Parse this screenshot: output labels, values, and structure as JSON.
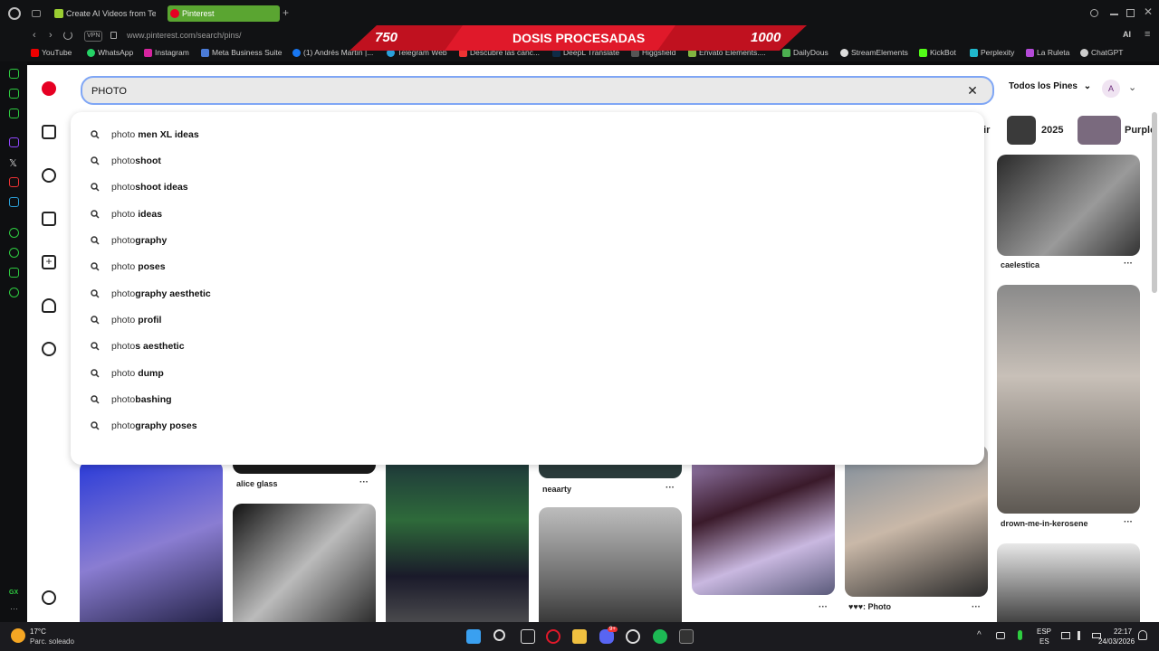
{
  "browser": {
    "tabs": [
      {
        "label": "Create AI Videos from Te"
      },
      {
        "label": "Pinterest"
      }
    ],
    "address": "www.pinterest.com/search/pins/",
    "vpn_label": "VPN",
    "ai_label": "AI",
    "bookmarks": [
      "YouTube",
      "WhatsApp",
      "Instagram",
      "Meta Business Suite",
      "(1) Andrés Martín |...",
      "Telegram Web",
      "Descubre las canc...",
      "DeepL Translate",
      "Higgsfield",
      "Envato Elements....",
      "DailyDous",
      "StreamElements",
      "KickBot",
      "Perplexity",
      "La Ruleta",
      "ChatGPT"
    ]
  },
  "overlay": {
    "left": "750",
    "center": "DOSIS PROCESADAS",
    "right": "1000"
  },
  "search": {
    "value": "PHOTO",
    "filter_label": "Todos los Pines",
    "avatar_letter": "A"
  },
  "suggestions": [
    {
      "prefix": "photo ",
      "rest": "men XL ideas"
    },
    {
      "prefix": "photo",
      "rest": "shoot"
    },
    {
      "prefix": "photo",
      "rest": "shoot ideas"
    },
    {
      "prefix": "photo ",
      "rest": "ideas"
    },
    {
      "prefix": "photo",
      "rest": "graphy"
    },
    {
      "prefix": "photo ",
      "rest": "poses"
    },
    {
      "prefix": "photo",
      "rest": "graphy aesthetic"
    },
    {
      "prefix": "photo ",
      "rest": "profil"
    },
    {
      "prefix": "photo",
      "rest": "s aesthetic"
    },
    {
      "prefix": "photo ",
      "rest": "dump"
    },
    {
      "prefix": "photo",
      "rest": "bashing"
    },
    {
      "prefix": "photo",
      "rest": "graphy poses"
    }
  ],
  "chips": [
    {
      "label": "air"
    },
    {
      "label": "2025"
    },
    {
      "label": "Purple"
    }
  ],
  "pins": {
    "captions": [
      "caelestica",
      "drown-me-in-kerosene",
      "alice glass",
      "neaarty",
      "♥♥♥: Photo"
    ]
  },
  "taskbar": {
    "weather_temp": "17°C",
    "weather_desc": "Parc. soleado",
    "lang_top": "ESP",
    "lang_bottom": "ES",
    "time": "22:17",
    "date": "24/03/2026",
    "notif_badge": "9+"
  },
  "gx": {
    "label": "GX"
  }
}
